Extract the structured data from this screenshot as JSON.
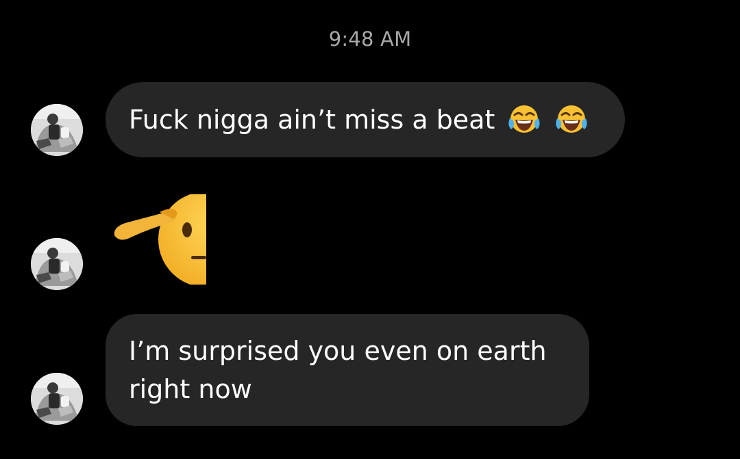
{
  "thread": {
    "timestamp": "9:48 AM",
    "messages": [
      {
        "text": "Fuck nigga ain’t miss a beat",
        "emoji": [
          "face-with-tears-of-joy-icon",
          "face-with-tears-of-joy-icon"
        ]
      },
      {
        "text": "",
        "emoji": [
          "saluting-face-icon"
        ]
      },
      {
        "text": "I’m surprised you even on earth right now",
        "emoji": []
      }
    ]
  },
  "colors": {
    "background": "#000000",
    "bubble": "#262626",
    "timestamp_text": "#a8a8a8",
    "message_text": "#ffffff",
    "emoji_yellow": "#f8c033"
  }
}
